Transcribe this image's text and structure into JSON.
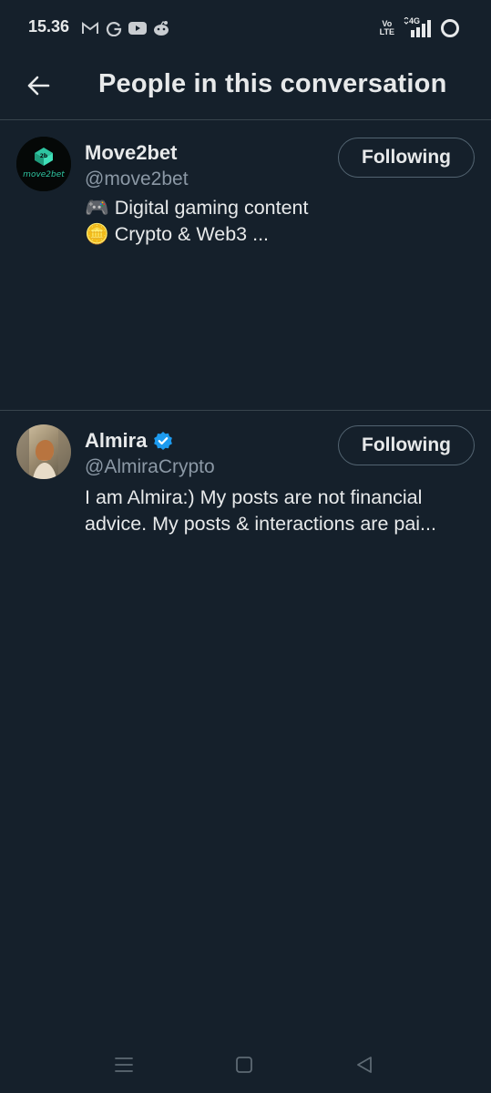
{
  "status_bar": {
    "time": "15.36",
    "left_icons": [
      "gmail-icon",
      "google-icon",
      "youtube-icon",
      "reddit-icon"
    ],
    "network": {
      "top": "Vo",
      "bottom": "LTE"
    },
    "signal_label": "4G",
    "icons_right": [
      "volte-icon",
      "signal-icon",
      "battery-saver-icon"
    ]
  },
  "header": {
    "title": "People in this conversation",
    "back_icon": "arrow-left-icon"
  },
  "people": [
    {
      "name": "Move2bet",
      "handle": "@move2bet",
      "verified": false,
      "bio_lines": [
        "🎮 Digital gaming content",
        "🪙 Crypto & Web3  ..."
      ],
      "follow_label": "Following",
      "avatar_text": "move2bet",
      "avatar_badge": "2b"
    },
    {
      "name": "Almira",
      "handle": "@AlmiraCrypto",
      "verified": true,
      "bio_lines": [
        "I am Almira:) My posts are not financial",
        "advice. My posts & interactions are pai..."
      ],
      "follow_label": "Following"
    }
  ],
  "nav": {
    "items": [
      "menu-icon",
      "home-icon",
      "back-icon"
    ]
  },
  "colors": {
    "background": "#15202b",
    "divider": "#38444d",
    "text_primary": "#e7e9ea",
    "text_secondary": "#8b98a5",
    "verified": "#1d9bf0",
    "avatar_accent": "#2ec4a0"
  }
}
